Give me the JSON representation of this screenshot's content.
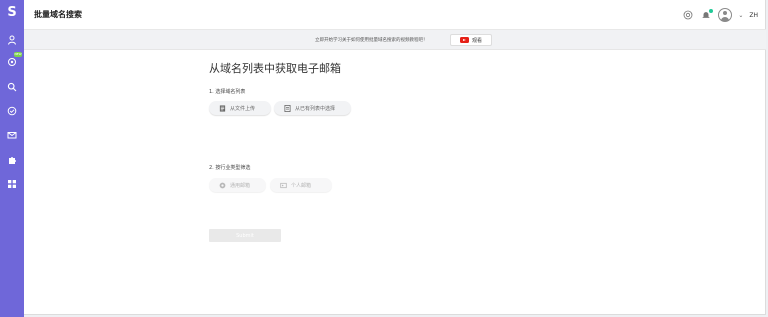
{
  "sidebar": {
    "logo": "S",
    "new_badge": "NEW",
    "items": [
      {
        "icon": "person-icon"
      },
      {
        "icon": "settings-icon"
      },
      {
        "icon": "search-icon"
      },
      {
        "icon": "check-circle-icon"
      },
      {
        "icon": "mail-icon"
      },
      {
        "icon": "puzzle-icon"
      },
      {
        "icon": "grid-icon"
      }
    ],
    "colors": {
      "background": "#6f67d9",
      "badge": "#7cd34b"
    }
  },
  "header": {
    "title": "批量域名搜索",
    "lang": "ZH",
    "icons": [
      "help-icon",
      "bell-icon",
      "avatar",
      "chevron-down-icon"
    ],
    "notification_dot_color": "#20c997"
  },
  "banner": {
    "text": "立即开始学习关于如何使用批量域名搜索的视频教程吧！",
    "watch_label": "观看",
    "watch_icon": "youtube-icon"
  },
  "main": {
    "title": "从域名列表中获取电子邮箱",
    "step1": {
      "label": "1. 选择域名列表",
      "options": [
        {
          "label": "从文件上传",
          "icon": "file-icon"
        },
        {
          "label": "从已有列表中选择",
          "icon": "list-icon"
        }
      ]
    },
    "step2": {
      "label": "2. 按行业类型筛选",
      "options": [
        {
          "label": "通用邮箱",
          "icon": "globe-icon"
        },
        {
          "label": "个人邮箱",
          "icon": "user-card-icon"
        }
      ]
    },
    "submit_label": "Submit"
  }
}
